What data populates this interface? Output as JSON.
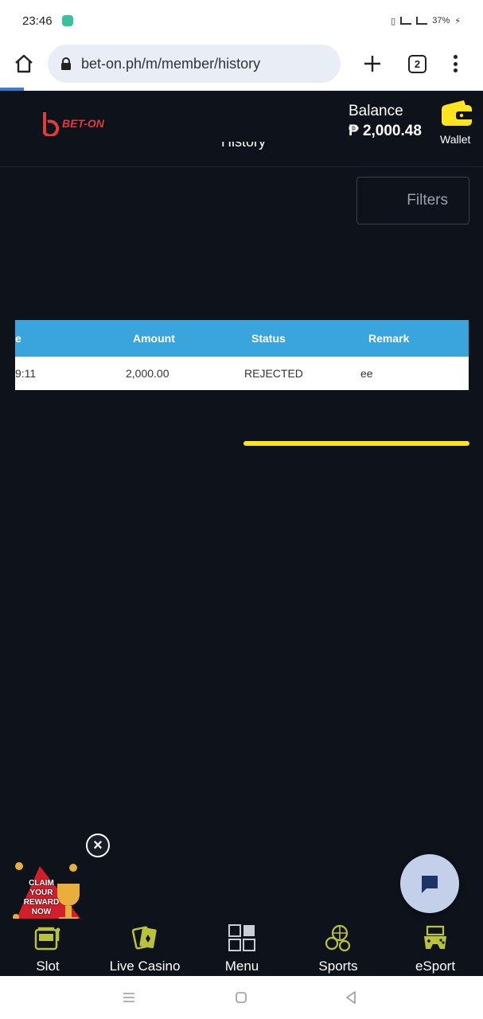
{
  "status_bar": {
    "time": "23:46",
    "battery": "37%"
  },
  "browser": {
    "url": "bet-on.ph/m/member/history",
    "tab_count": "2"
  },
  "header": {
    "logo_text": "BET-ON",
    "balance_label": "Balance",
    "balance_amount": "₱ 2,000.48",
    "wallet_label": "Wallet",
    "page_title": "History"
  },
  "filters": {
    "label": "Filters"
  },
  "table": {
    "columns": [
      "e",
      "Amount",
      "Status",
      "Remark"
    ],
    "rows": [
      {
        "time": "9:11",
        "amount": "2,000.00",
        "status": "REJECTED",
        "remark": "ee"
      }
    ]
  },
  "promo": {
    "text": "CLAIM YOUR REWARD NOW",
    "close_icon": "close-icon"
  },
  "bottom_nav": {
    "items": [
      {
        "label": "Slot",
        "icon": "slot-machine-icon"
      },
      {
        "label": "Live Casino",
        "icon": "cards-icon"
      },
      {
        "label": "Menu",
        "icon": "grid-icon"
      },
      {
        "label": "Sports",
        "icon": "balls-icon"
      },
      {
        "label": "eSport",
        "icon": "gamepad-icon"
      }
    ]
  },
  "colors": {
    "accent_yellow": "#ffe41f",
    "table_header": "#3aa5dc",
    "background": "#0e121b",
    "sport_icon": "#b9c23a"
  }
}
